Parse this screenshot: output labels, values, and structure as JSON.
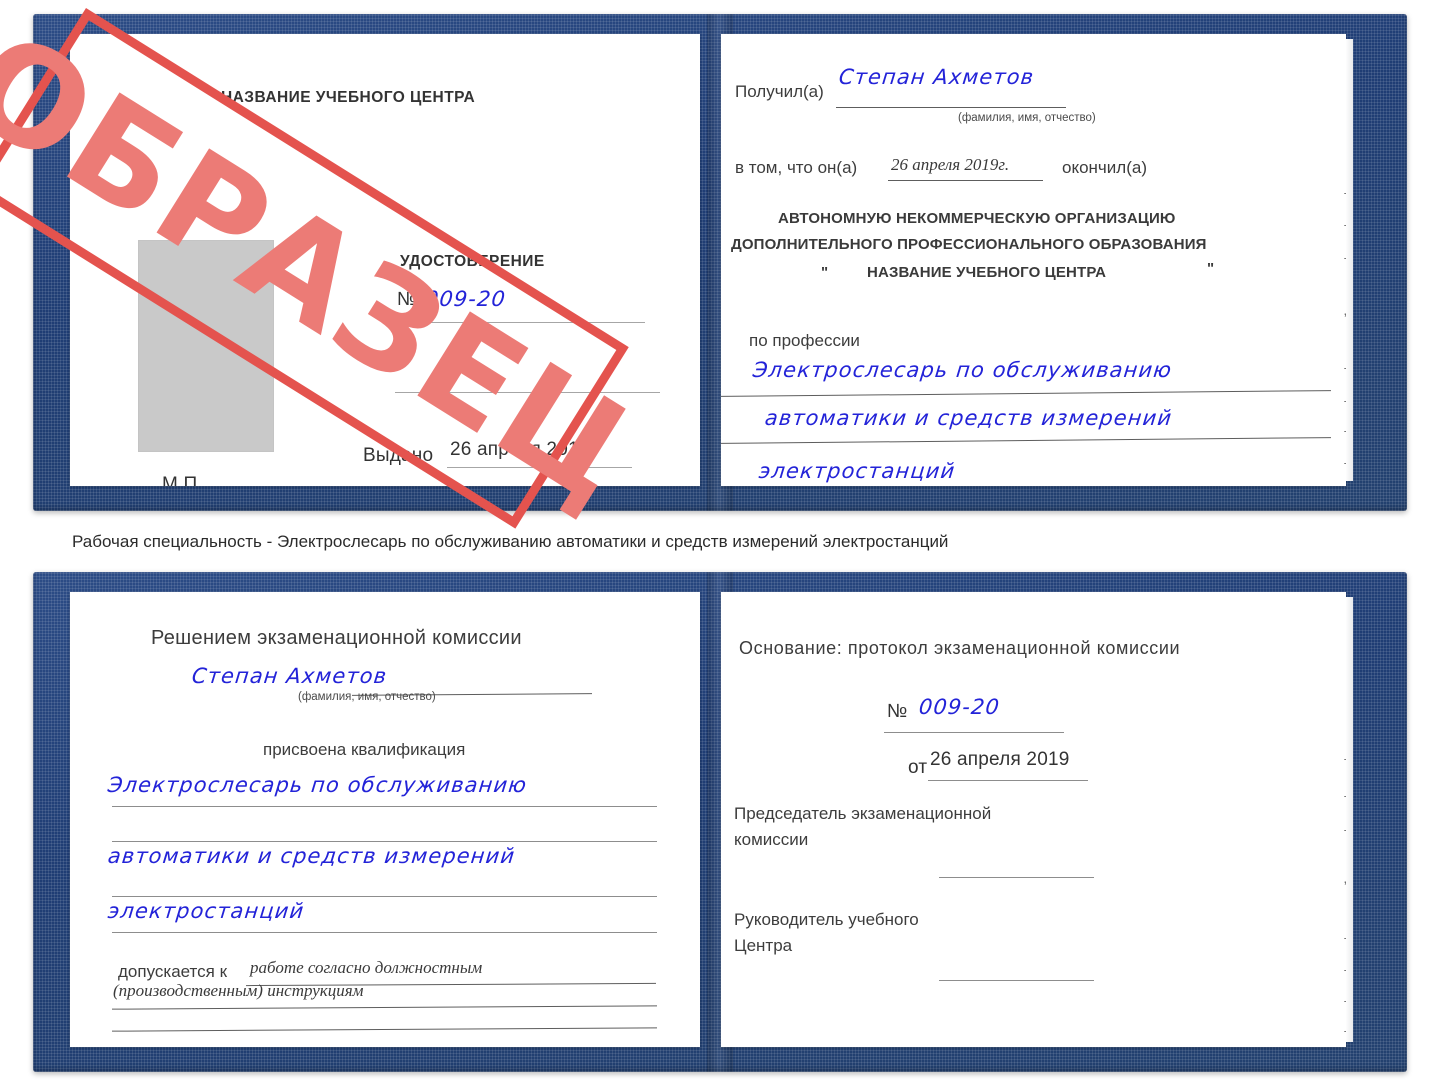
{
  "caption": {
    "text": "Рабочая специальность - Электрослесарь по обслуживанию автоматики и средств измерений электростанций"
  },
  "colors": {
    "cover_blue": "#23416f",
    "stamp_red": "#e4534e",
    "stamp_text_red": "#ec7b76",
    "handwriting_blue": "#2323d8",
    "photo_placeholder_grey": "#c9c9c9",
    "rule_grey": "#8d8d8d"
  },
  "watermark": {
    "text": "ОБРАЗЕЦ"
  },
  "certificate_top": {
    "left_page": {
      "center_name": "НАЗВАНИЕ УЧЕБНОГО ЦЕНТРА",
      "doc_type": "УДОСТОВЕРЕНИЕ",
      "number_label": "№",
      "number_value": "009-20",
      "issued_label": "Выдано",
      "issued_value": "26 апреля 2019",
      "seal_label": "М.П.",
      "photo_placeholder": ""
    },
    "right_page": {
      "received_label": "Получил(а)",
      "received_value": "Степан Ахметов",
      "received_hint": "(фамилия, имя, отчество)",
      "that_he_label": "в том, что он(а)",
      "that_he_value": "26 апреля 2019г.",
      "graduated_label": "окончил(а)",
      "org_line1": "АВТОНОМНУЮ НЕКОММЕРЧЕСКУЮ ОРГАНИЗАЦИЮ",
      "org_line2": "ДОПОЛНИТЕЛЬНОГО ПРОФЕССИОНАЛЬНОГО ОБРАЗОВАНИЯ",
      "org_quote_open": "\"",
      "org_line3": "НАЗВАНИЕ УЧЕБНОГО ЦЕНТРА",
      "org_quote_close": "\"",
      "profession_label": "по профессии",
      "profession_line1": "Электрослесарь по обслуживанию",
      "profession_line2": "автоматики и средств измерений",
      "profession_line3": "электростанций",
      "edge_fragments": [
        "–",
        "–",
        "–",
        "–",
        "и",
        ",а",
        "‹-",
        "–",
        "–",
        "–"
      ]
    }
  },
  "certificate_bottom": {
    "left_page": {
      "heading": "Решением экзаменационной комиссии",
      "name_value": "Степан Ахметов",
      "name_hint": "(фамилия, имя, отчество)",
      "qualification_label": "присвоена квалификация",
      "qualification_line1": "Электрослесарь по обслуживанию",
      "qualification_line2": "автоматики и средств измерений",
      "qualification_line3": "электростанций",
      "admitted_label": "допускается к",
      "admitted_value_line1": "работе согласно должностным",
      "admitted_value_line2": "(производственным) инструкциям"
    },
    "right_page": {
      "basis_label": "Основание: протокол экзаменационной комиссии",
      "number_label": "№",
      "number_value": "009-20",
      "date_label": "от",
      "date_value": "26 апреля 2019",
      "chairman_line1": "Председатель экзаменационной",
      "chairman_line2": "комиссии",
      "head_line1": "Руководитель учебного",
      "head_line2": "Центра",
      "edge_fragments": [
        "–",
        "–",
        "–",
        "и",
        ",а",
        "‹-",
        "–",
        "–",
        "–",
        "–"
      ]
    }
  }
}
